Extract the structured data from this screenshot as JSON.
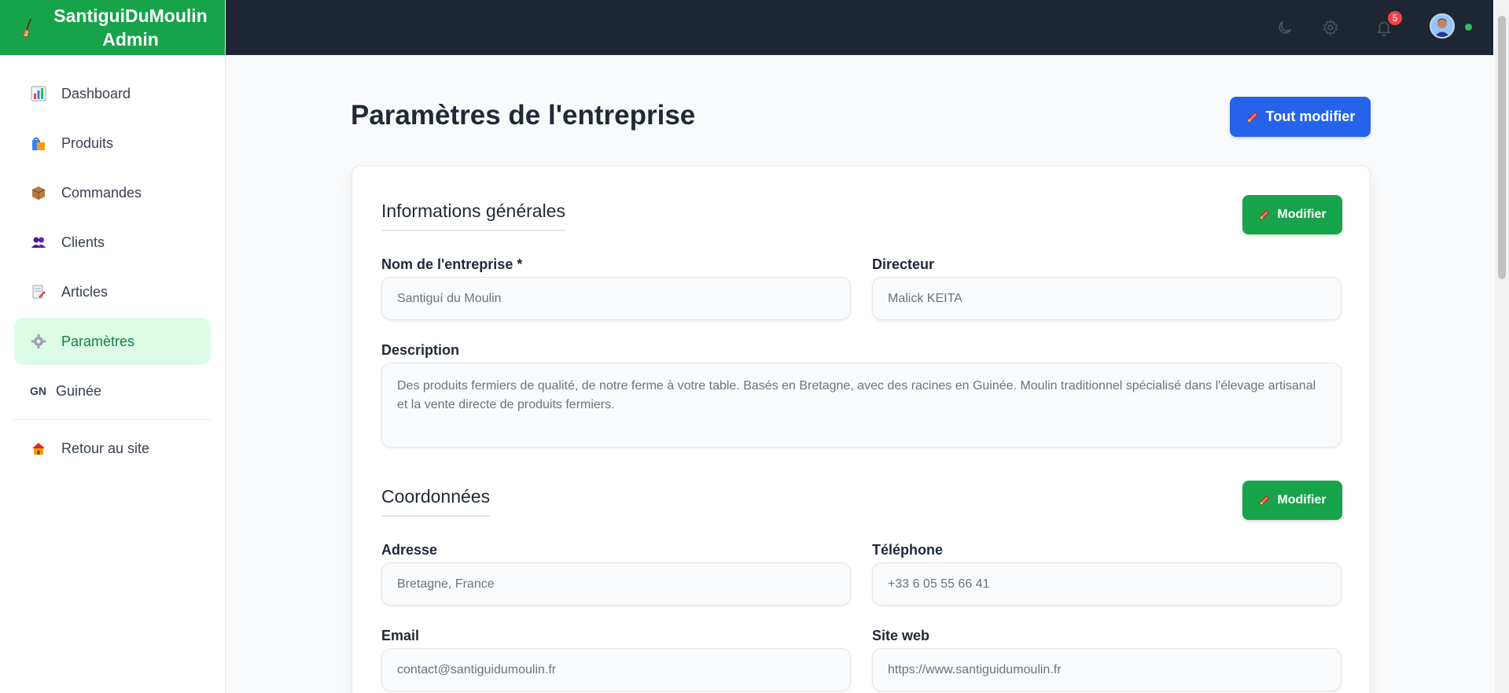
{
  "app": {
    "brand_title": "SantiguiDuMoulin Admin"
  },
  "sidebar": {
    "items": [
      {
        "label": "Dashboard",
        "icon": "bar-chart-icon"
      },
      {
        "label": "Produits",
        "icon": "shopping-bags-icon"
      },
      {
        "label": "Commandes",
        "icon": "package-icon"
      },
      {
        "label": "Clients",
        "icon": "users-icon"
      },
      {
        "label": "Articles",
        "icon": "memo-icon"
      },
      {
        "label": "Paramètres",
        "icon": "gear-icon",
        "active": true
      },
      {
        "label": "Guinée",
        "icon_text": "GN"
      },
      {
        "label": "Retour au site",
        "icon": "house-icon"
      }
    ]
  },
  "topbar": {
    "notification_count": "5"
  },
  "page": {
    "title": "Paramètres de l'entreprise",
    "edit_all_label": "Tout modifier"
  },
  "sections": {
    "general": {
      "title": "Informations générales",
      "modify_label": "Modifier",
      "company_name_label": "Nom de l'entreprise *",
      "company_name_value": "Santiguí du Moulin",
      "director_label": "Directeur",
      "director_value": "Malick KEITA",
      "description_label": "Description",
      "description_value": "Des produits fermiers de qualité, de notre ferme à votre table. Basés en Bretagne, avec des racines en Guinée. Moulin traditionnel spécialisé dans l'élevage artisanal et la vente directe de produits fermiers."
    },
    "contact": {
      "title": "Coordonnées",
      "modify_label": "Modifier",
      "address_label": "Adresse",
      "address_value": "Bretagne, France",
      "phone_label": "Téléphone",
      "phone_value": "+33 6 05 55 66 41",
      "email_label": "Email",
      "email_value": "contact@santiguidumoulin.fr",
      "website_label": "Site web",
      "website_value": "https://www.santiguidumoulin.fr"
    }
  },
  "colors": {
    "brand_green": "#16a34a",
    "primary_blue": "#2563eb",
    "topbar_dark": "#1e2533",
    "active_bg": "#dcfce7",
    "badge_red": "#ef4444"
  }
}
